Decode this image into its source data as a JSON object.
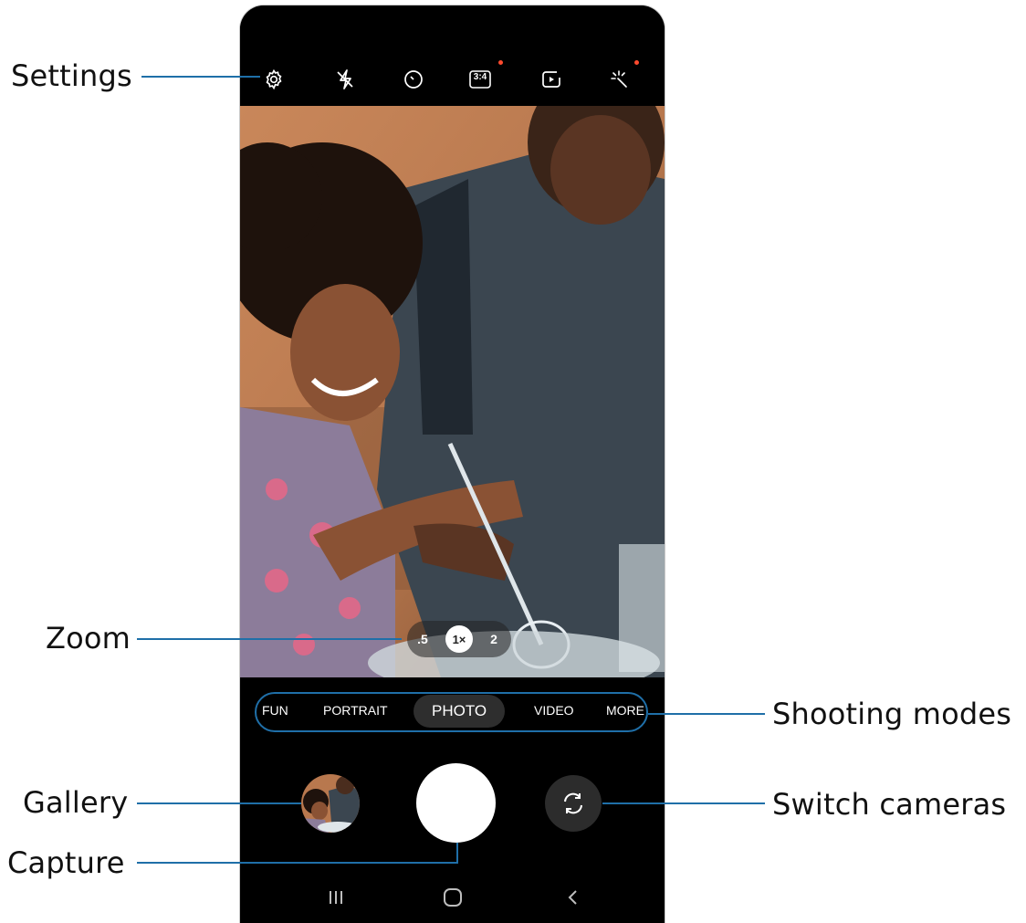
{
  "callouts": {
    "settings": "Settings",
    "zoom": "Zoom",
    "shooting_modes": "Shooting modes",
    "gallery": "Gallery",
    "capture": "Capture",
    "switch_cameras": "Switch cameras"
  },
  "top_bar": {
    "icons": [
      "gear-icon",
      "flash-off-icon",
      "timer-icon",
      "aspect-ratio-icon",
      "motion-photo-icon",
      "filter-icon"
    ],
    "ratio_label": "3:4",
    "notification_dot_color": "#ff4a2e"
  },
  "zoom": {
    "options": [
      ".5",
      "1×",
      "2"
    ],
    "active": "1×"
  },
  "modes": {
    "items": [
      "FUN",
      "PORTRAIT",
      "PHOTO",
      "VIDEO",
      "MORE"
    ],
    "active": "PHOTO"
  },
  "colors": {
    "callout_line": "#1f6fa8",
    "camera_bg": "#000000"
  },
  "nav": {
    "icons": [
      "recent-apps-icon",
      "home-icon",
      "back-icon"
    ]
  }
}
